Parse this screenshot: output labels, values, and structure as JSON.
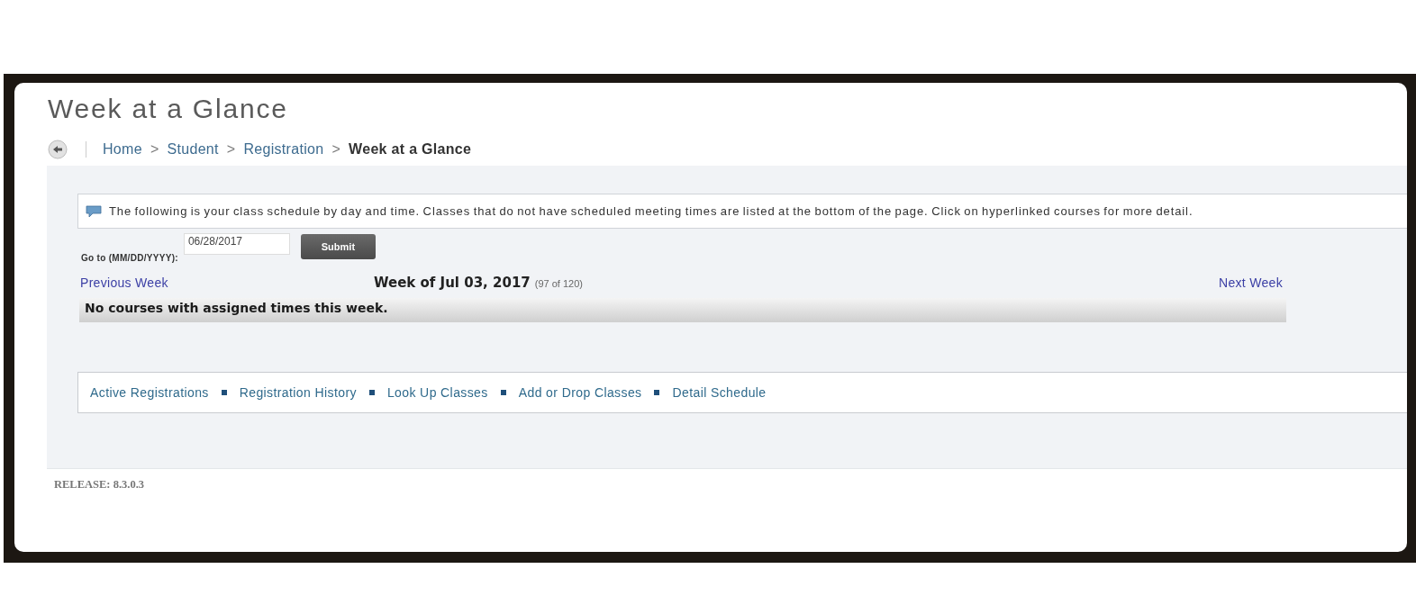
{
  "page": {
    "title": "Week at a Glance"
  },
  "breadcrumb": [
    {
      "label": "Home",
      "current": false,
      "separator": ">"
    },
    {
      "label": "Student",
      "current": false,
      "separator": ">"
    },
    {
      "label": "Registration",
      "current": false,
      "separator": ">"
    },
    {
      "label": "Week at a Glance",
      "current": true
    }
  ],
  "info_message": "The following is your class schedule by day and time. Classes that do not have scheduled meeting times are listed at the bottom of the page. Click on hyperlinked courses for more detail.",
  "goto": {
    "label": "Go to (MM/DD/YYYY):",
    "value": "06/28/2017",
    "button": "Submit"
  },
  "week_nav": {
    "previous": "Previous Week",
    "heading": "Week of Jul 03, 2017",
    "position": "(97 of 120)",
    "next": "Next Week"
  },
  "notice": "No courses with assigned times this week.",
  "links": [
    "Active Registrations",
    "Registration History",
    "Look Up Classes",
    "Add or Drop Classes",
    "Detail Schedule"
  ],
  "release": "RELEASE: 8.3.0.3"
}
